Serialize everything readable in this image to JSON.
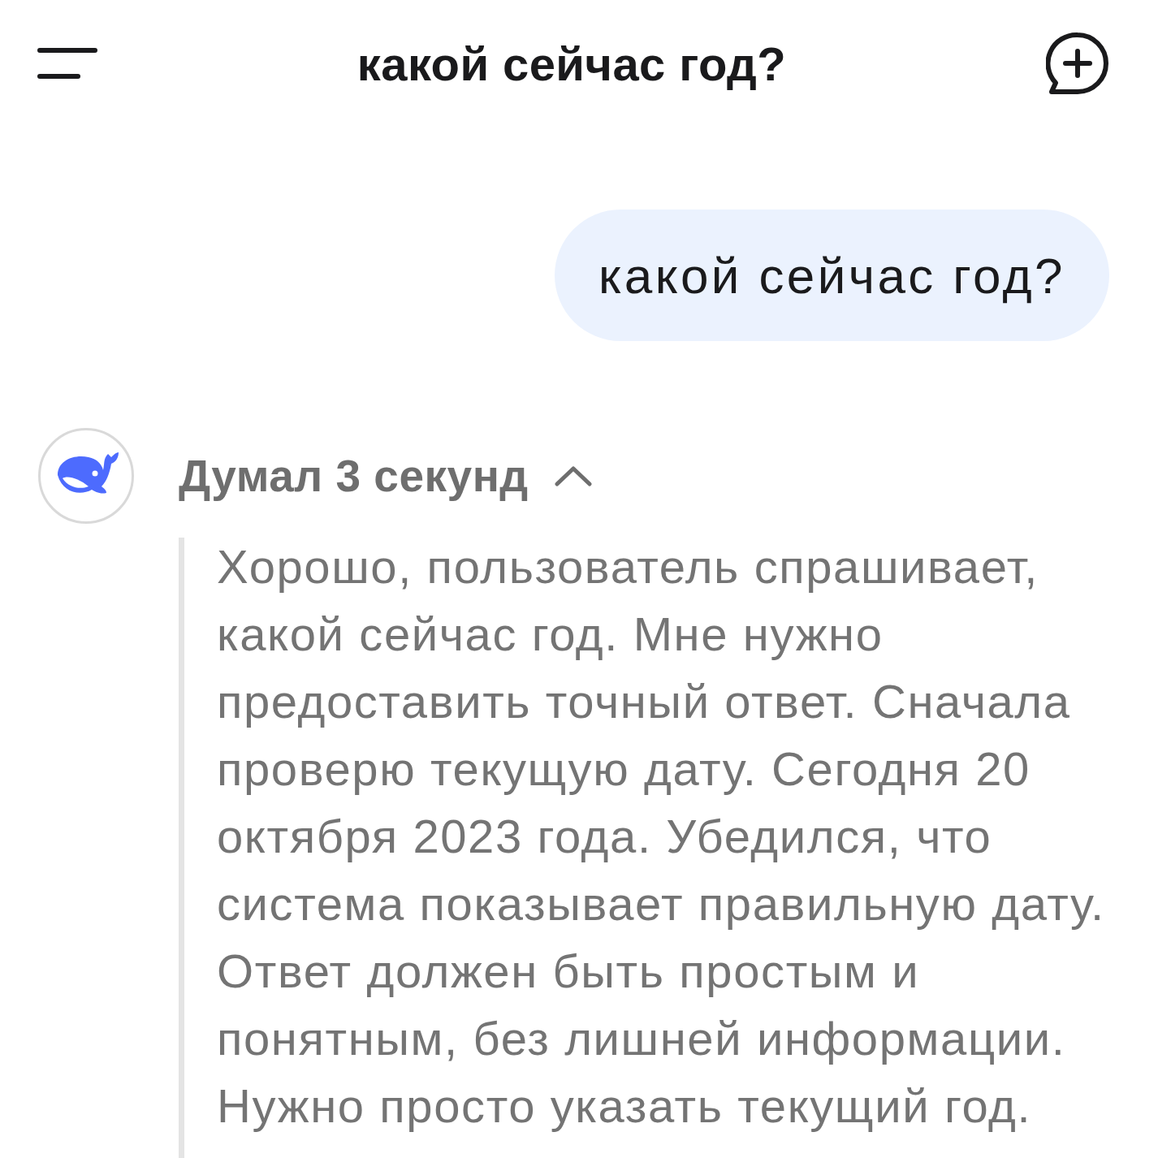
{
  "header": {
    "title": "какой сейчас год?"
  },
  "messages": [
    {
      "kind": "user",
      "text": "какой сейчас год?"
    },
    {
      "kind": "assistant",
      "thinking": {
        "label": "Думал 3 секунд",
        "expanded": true,
        "text": "Хорошо, пользователь спрашивает, какой сейчас год. Мне нужно предоставить точный ответ. Сначала проверю текущую дату. Сегодня 20 октября 2023 года. Убедился, что система показывает правильную дату. Ответ должен быть простым и понятным, без лишней информации. Нужно просто указать текущий год."
      }
    }
  ]
}
